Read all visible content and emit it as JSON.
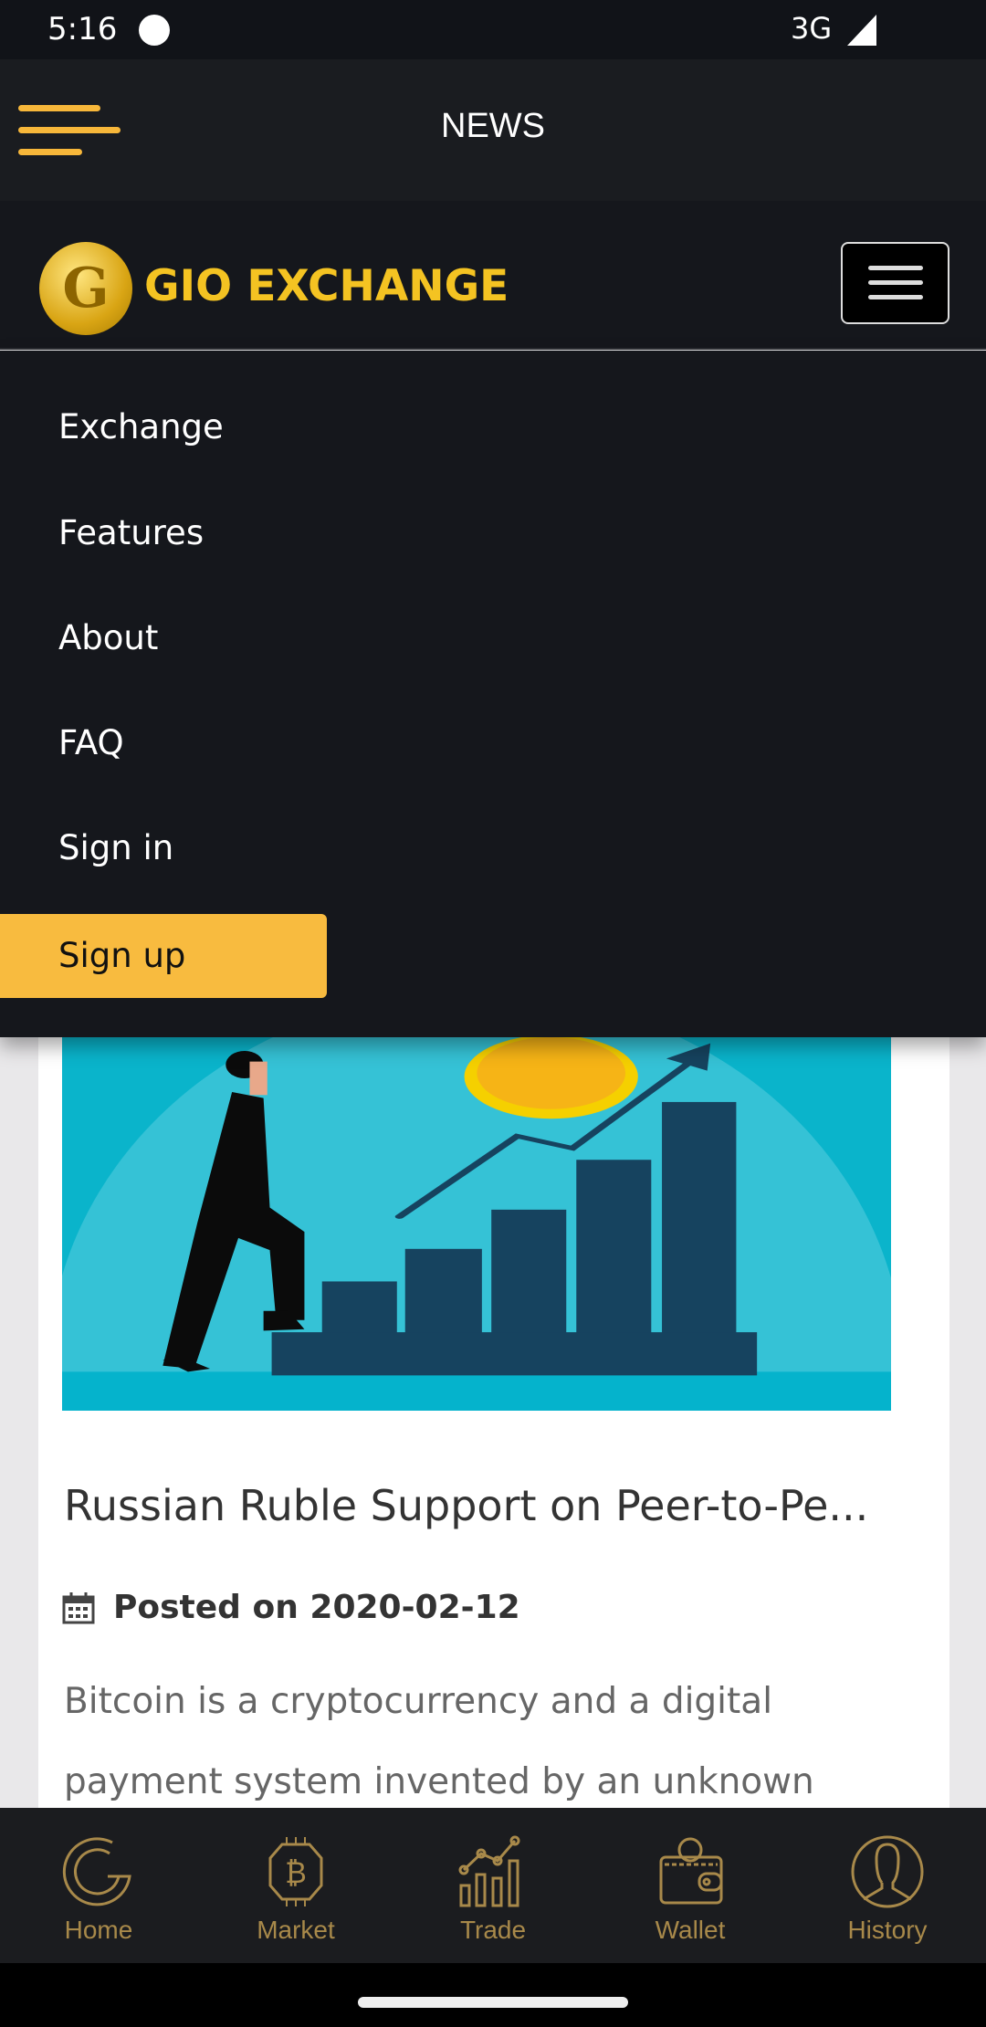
{
  "status_bar": {
    "time": "5:16",
    "network": "3G"
  },
  "app_bar": {
    "title": "NEWS",
    "menu_icon": "hamburger-icon"
  },
  "site_header": {
    "brand": "GIO EXCHANGE",
    "logo_letter": "G",
    "toggle_icon": "hamburger-icon"
  },
  "menu": {
    "items": [
      {
        "label": "Exchange"
      },
      {
        "label": "Features"
      },
      {
        "label": "About"
      },
      {
        "label": "FAQ"
      },
      {
        "label": "Sign in"
      }
    ],
    "signup": "Sign up"
  },
  "post": {
    "title": "Russian Ruble Support on Peer-to-Pe...",
    "posted_prefix": "Posted on",
    "date": "2020-02-12",
    "excerpt": "Bitcoin is a cryptocurrency and a digital payment system invented by an unknown"
  },
  "bottom_nav": {
    "items": [
      {
        "label": "Home",
        "icon": "g-logo-icon"
      },
      {
        "label": "Market",
        "icon": "bitcoin-chip-icon"
      },
      {
        "label": "Trade",
        "icon": "chart-icon"
      },
      {
        "label": "Wallet",
        "icon": "wallet-icon"
      },
      {
        "label": "History",
        "icon": "user-icon"
      }
    ]
  },
  "colors": {
    "accent": "#f8bb3f",
    "brand_text": "#f4c322",
    "nav_icon": "#a8894a",
    "dark_bg": "#15171c"
  }
}
